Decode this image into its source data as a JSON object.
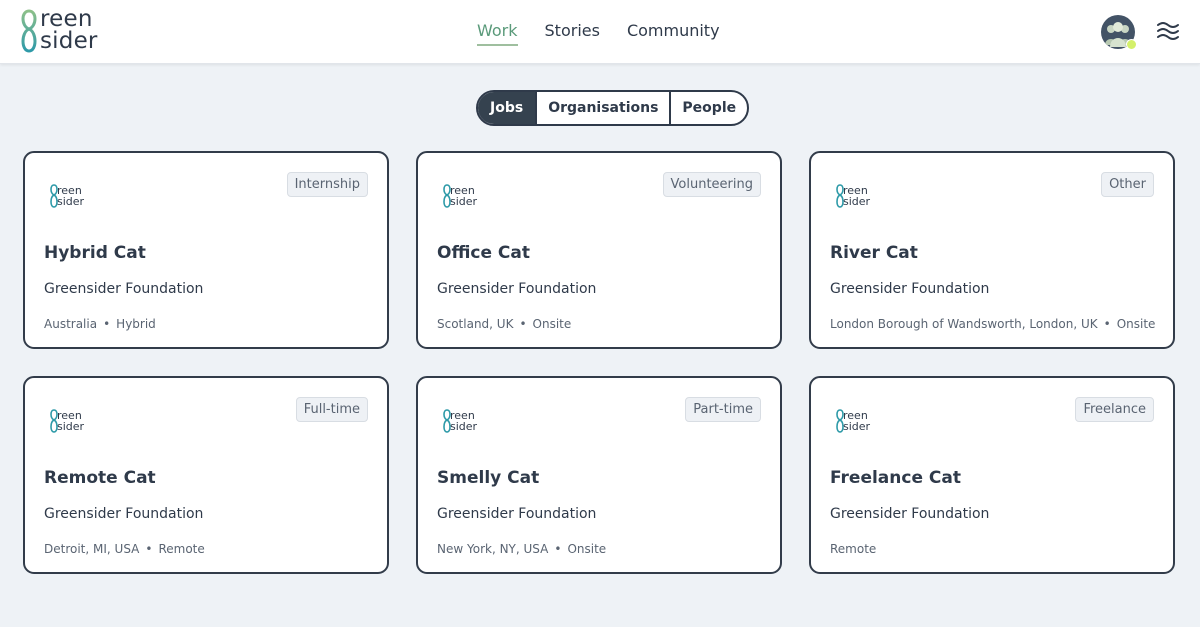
{
  "header": {
    "logo_line1": "reen",
    "logo_line2": "sider",
    "nav": [
      "Work",
      "Stories",
      "Community"
    ]
  },
  "segments": [
    "Jobs",
    "Organisations",
    "People"
  ],
  "cards": [
    {
      "badge": "Internship",
      "title": "Hybrid Cat",
      "org": "Greensider Foundation",
      "location": "Australia",
      "mode": "Hybrid"
    },
    {
      "badge": "Volunteering",
      "title": "Office Cat",
      "org": "Greensider Foundation",
      "location": "Scotland, UK",
      "mode": "Onsite"
    },
    {
      "badge": "Other",
      "title": "River Cat",
      "org": "Greensider Foundation",
      "location": "London Borough of Wandsworth, London, UK",
      "mode": "Onsite"
    },
    {
      "badge": "Full-time",
      "title": "Remote Cat",
      "org": "Greensider Foundation",
      "location": "Detroit, MI, USA",
      "mode": "Remote"
    },
    {
      "badge": "Part-time",
      "title": "Smelly Cat",
      "org": "Greensider Foundation",
      "location": "New York, NY, USA",
      "mode": "Onsite"
    },
    {
      "badge": "Freelance",
      "title": "Freelance Cat",
      "org": "Greensider Foundation",
      "location": "",
      "mode": "Remote"
    }
  ],
  "colors": {
    "accent_nav": "#5a9a7a",
    "logo_gradient_start": "#2e9aa8",
    "logo_gradient_end": "#8cc08a",
    "card_border": "#323c4a",
    "status_dot": "#d4f06a"
  }
}
